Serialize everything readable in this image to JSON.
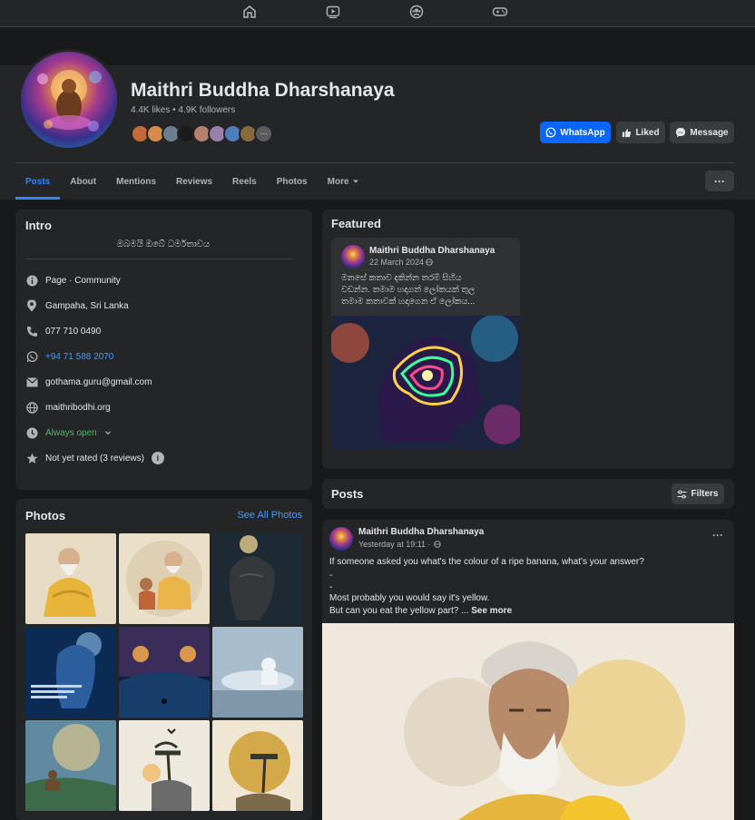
{
  "page": {
    "name": "Maithri Buddha Dharshanaya",
    "stats": "4.4K likes • 4.9K followers"
  },
  "buttons": {
    "whatsapp": "WhatsApp",
    "liked": "Liked",
    "message": "Message",
    "more": "···"
  },
  "tabs": [
    "Posts",
    "About",
    "Mentions",
    "Reviews",
    "Reels",
    "Photos",
    "More"
  ],
  "intro": {
    "title": "Intro",
    "bio": "ඔබමයි ඔබේ ධර්මතාවය",
    "category": "Page · Community",
    "location": "Gampaha, Sri Lanka",
    "phone": "077 710 0490",
    "whatsapp": "+94 71 588 2070",
    "email": "gothama.guru@gmail.com",
    "website": "maithribodhi.org",
    "hours": "Always open",
    "rating": "Not yet rated (3 reviews)"
  },
  "photos": {
    "title": "Photos",
    "see_all": "See All Photos"
  },
  "featured": {
    "title": "Featured",
    "author": "Maithri Buddha Dharshanaya",
    "date": "22 March 2024",
    "text_line1": "මනසේ කතාව දකින්න තරම් සිහිය",
    "text_line2": "වඩන්න. තමාම හදාගත් ලෝකයක් තුල",
    "text_line3": "තමාම කතාවක් හදාගෙන ඒ ලෝකය..."
  },
  "posts": {
    "title": "Posts",
    "filters": "Filters",
    "author": "Maithri Buddha Dharshanaya",
    "time": "Yesterday at 19:11 ·",
    "line1": "If someone asked you what's the colour of a ripe banana, what's your answer?",
    "line2": "-",
    "line3": "-",
    "line4": "Most probably you would say it's yellow.",
    "line5": "But can you eat the yellow part? ...",
    "see_more": "See more",
    "options": "···"
  },
  "colors": {
    "accent": "#2d88ff",
    "whatsapp_button": "#0866ff",
    "open_status": "#45bd62",
    "card": "#242526",
    "background": "#18191a"
  }
}
